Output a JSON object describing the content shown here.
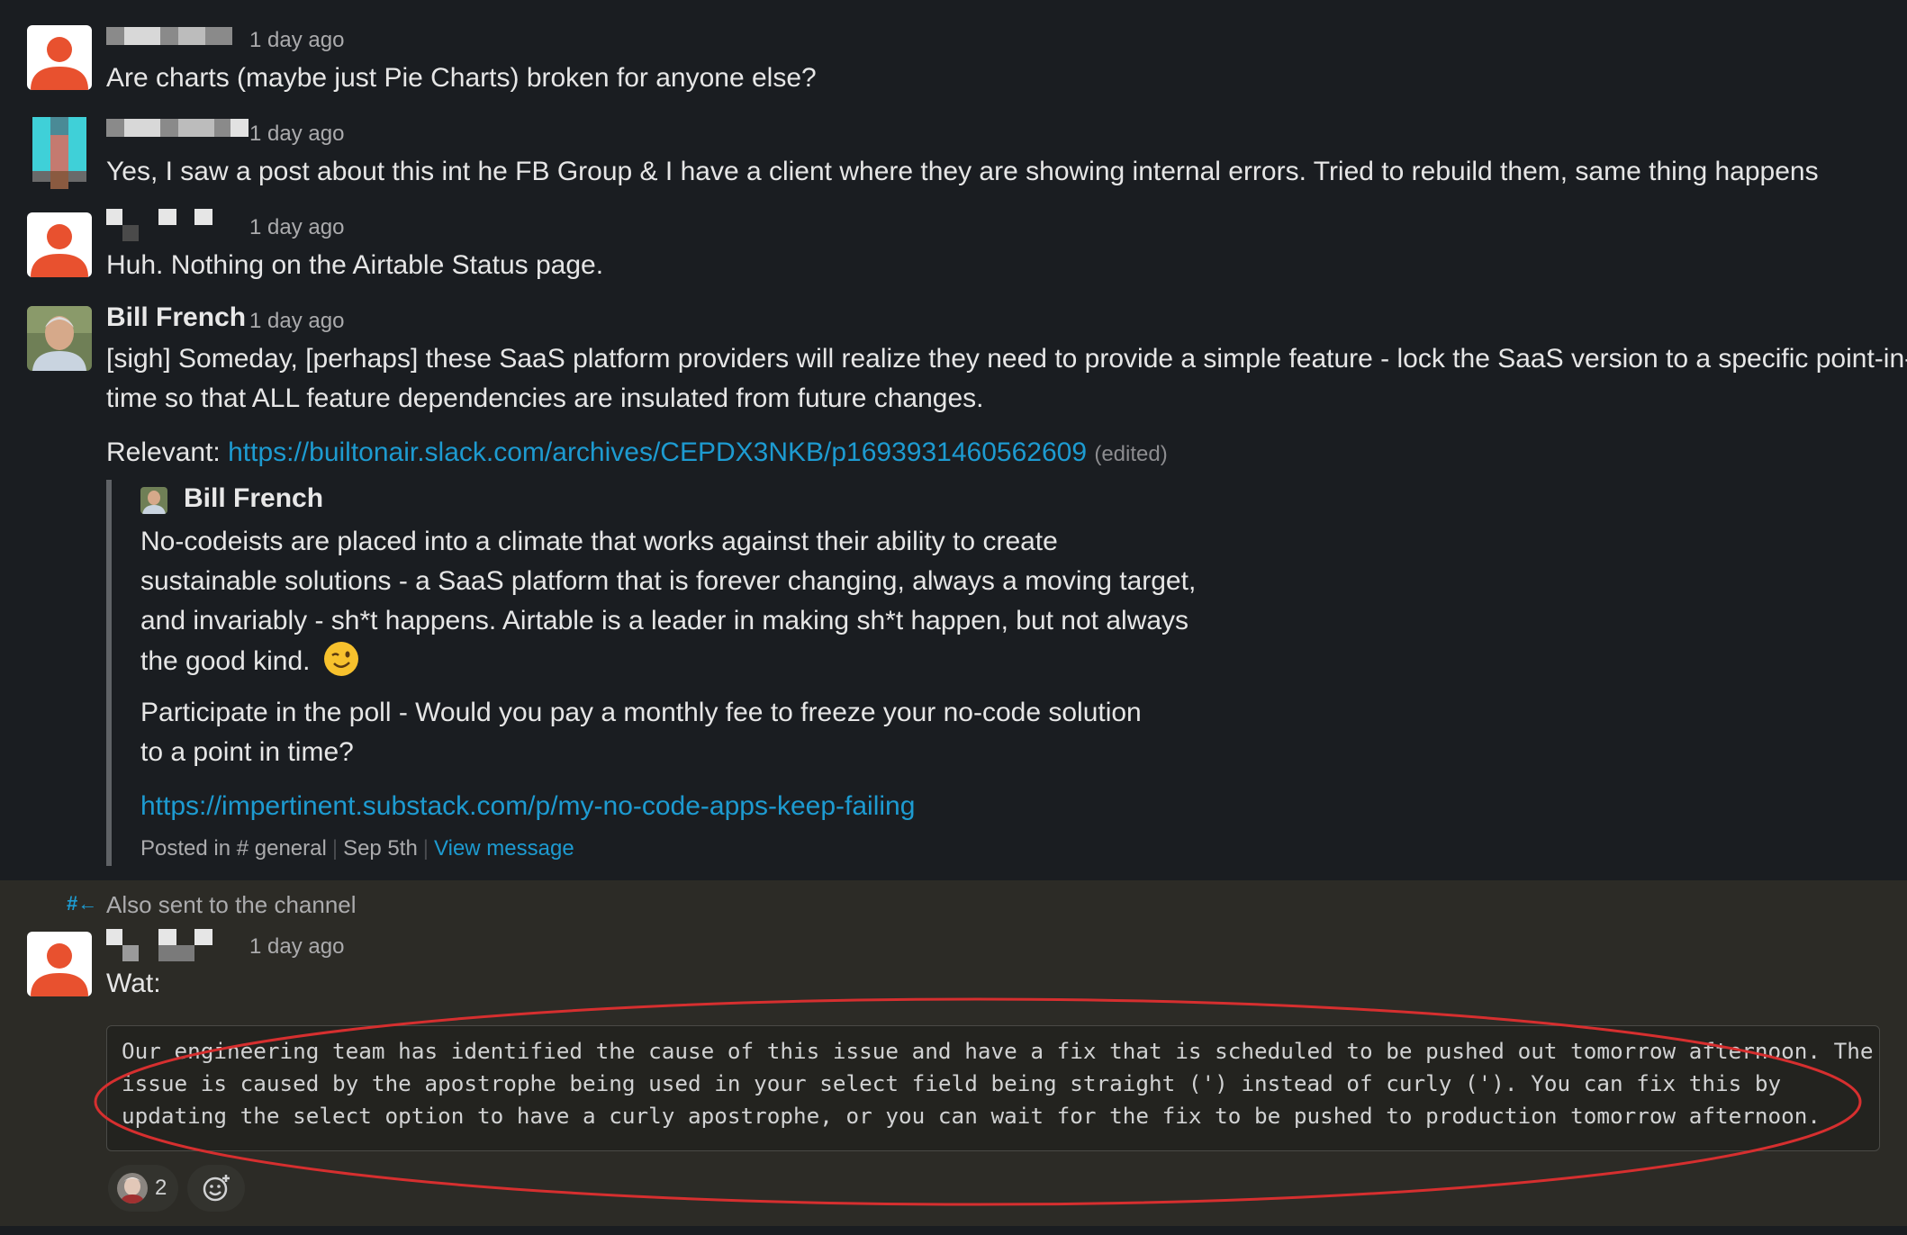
{
  "messages": [
    {
      "author": "",
      "time": "1 day ago",
      "text": "Are charts (maybe just Pie Charts) broken for anyone else?"
    },
    {
      "author": "",
      "time": "1 day ago",
      "text": "Yes, I saw a post about this int he FB Group & I have a client where they are showing internal errors. Tried to rebuild them, same thing happens"
    },
    {
      "author": "",
      "time": "1 day ago",
      "text": "Huh. Nothing on the Airtable Status page."
    },
    {
      "author": "Bill French",
      "time": "1 day ago",
      "text_line1": "[sigh] Someday, [perhaps] these SaaS platform providers will realize they need to provide a simple feature - lock the SaaS version to a specific point-in-",
      "text_line2": "time so that ALL feature dependencies are insulated from future changes.",
      "relevant_label": "Relevant:",
      "relevant_link": "https://builtonair.slack.com/archives/CEPDX3NKB/p1693931460562609",
      "edited": "(edited)",
      "quote": {
        "author": "Bill French",
        "line1": "No-codeists are placed into a climate that works against their ability to create",
        "line2": "sustainable solutions - a SaaS platform that is forever changing, always a moving target,",
        "line3": "and invariably - sh*t happens. Airtable is a leader in making sh*t happen, but not always",
        "line4": "the good kind.",
        "emoji": "😉",
        "line5": "Participate in the poll - Would you pay a monthly fee to freeze your no-code solution",
        "line6": "to a point in time?",
        "link": "https://impertinent.substack.com/p/my-no-code-apps-keep-failing",
        "posted_in": "Posted in",
        "channel": "# general",
        "date": "Sep 5th",
        "view_message": "View message"
      }
    },
    {
      "also_sent": "Also sent to the channel",
      "author": "",
      "time": "1 day ago",
      "text": "Wat:",
      "code_line1": "Our engineering team has identified the cause of this issue and have a fix that is scheduled to be pushed out tomorrow afternoon. The",
      "code_line2": "issue is caused by the apostrophe being used in your select field being straight (') instead of curly ('). You can fix this by",
      "code_line3": "updating the select option to have a curly apostrophe, or you can wait for the fix to be pushed to production tomorrow afternoon.",
      "reaction_count": "2"
    }
  ],
  "colors": {
    "background": "#1a1d21",
    "highlight": "#2c2b26",
    "link": "#1d9bd1",
    "default_avatar": "#e8512f",
    "annotation": "#d62f2f"
  }
}
